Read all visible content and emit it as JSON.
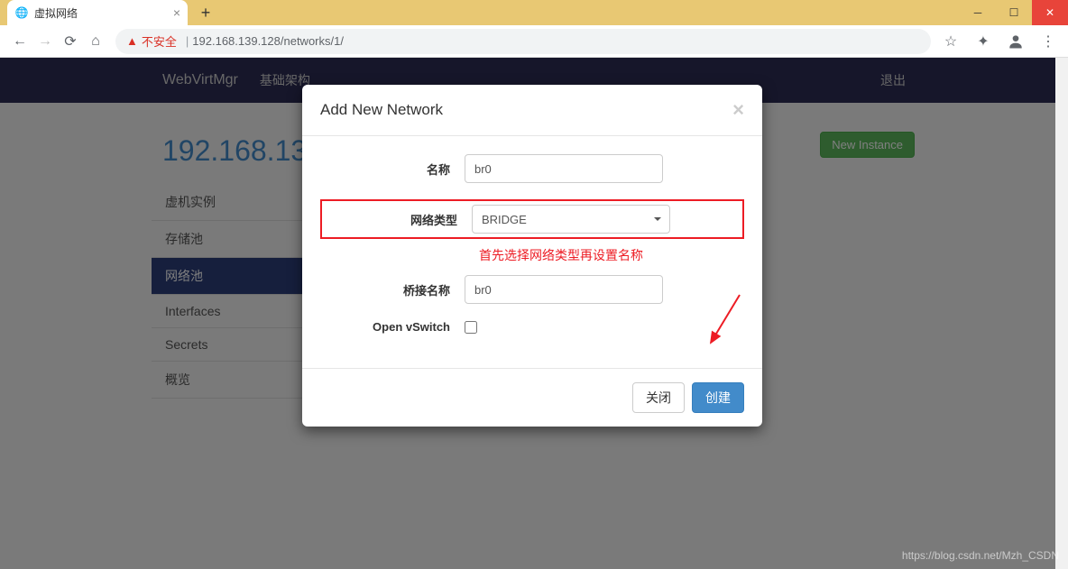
{
  "browser": {
    "tab_title": "虚拟网络",
    "insecure_label": "不安全",
    "url": "192.168.139.128/networks/1/"
  },
  "navbar": {
    "brand": "WebVirtMgr",
    "link_infra": "基础架构",
    "logout": "退出"
  },
  "page": {
    "header_ip": "192.168.139",
    "new_instance_label": "New Instance"
  },
  "sidebar": {
    "items": [
      {
        "label": "虚机实例"
      },
      {
        "label": "存储池"
      },
      {
        "label": "网络池"
      },
      {
        "label": "Interfaces"
      },
      {
        "label": "Secrets"
      },
      {
        "label": "概览"
      }
    ],
    "active_index": 2
  },
  "modal": {
    "title": "Add New Network",
    "close_symbol": "×",
    "fields": {
      "name_label": "名称",
      "name_value": "br0",
      "type_label": "网络类型",
      "type_value": "BRIDGE",
      "bridge_label": "桥接名称",
      "bridge_value": "br0",
      "ovs_label": "Open vSwitch"
    },
    "annotation": "首先选择网络类型再设置名称",
    "footer": {
      "close": "关闭",
      "create": "创建"
    }
  },
  "watermark": "https://blog.csdn.net/Mzh_CSDN"
}
